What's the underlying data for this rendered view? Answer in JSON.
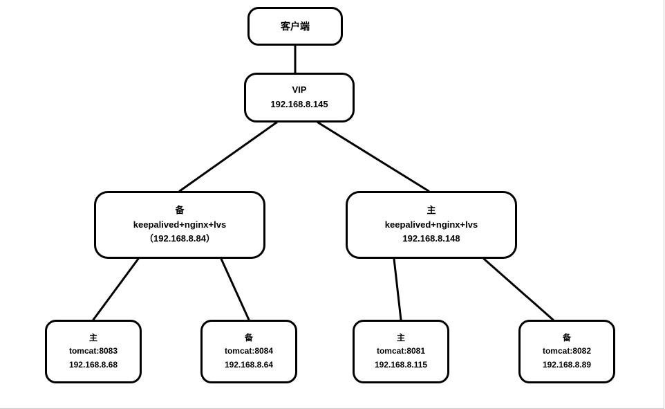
{
  "client": {
    "label": "客户端"
  },
  "vip": {
    "label": "VIP",
    "ip": "192.168.8.145"
  },
  "lb_backup": {
    "role": "备",
    "stack": "keepalived+nginx+lvs",
    "ip_display": "（192.168.8.84）"
  },
  "lb_master": {
    "role": "主",
    "stack": "keepalived+nginx+lvs",
    "ip_display": "192.168.8.148"
  },
  "tomcat1": {
    "role": "主",
    "service": "tomcat:8083",
    "ip": "192.168.8.68"
  },
  "tomcat2": {
    "role": "备",
    "service": "tomcat:8084",
    "ip": "192.168.8.64"
  },
  "tomcat3": {
    "role": "主",
    "service": "tomcat:8081",
    "ip": "192.168.8.115"
  },
  "tomcat4": {
    "role": "备",
    "service": "tomcat:8082",
    "ip": "192.168.8.89"
  }
}
